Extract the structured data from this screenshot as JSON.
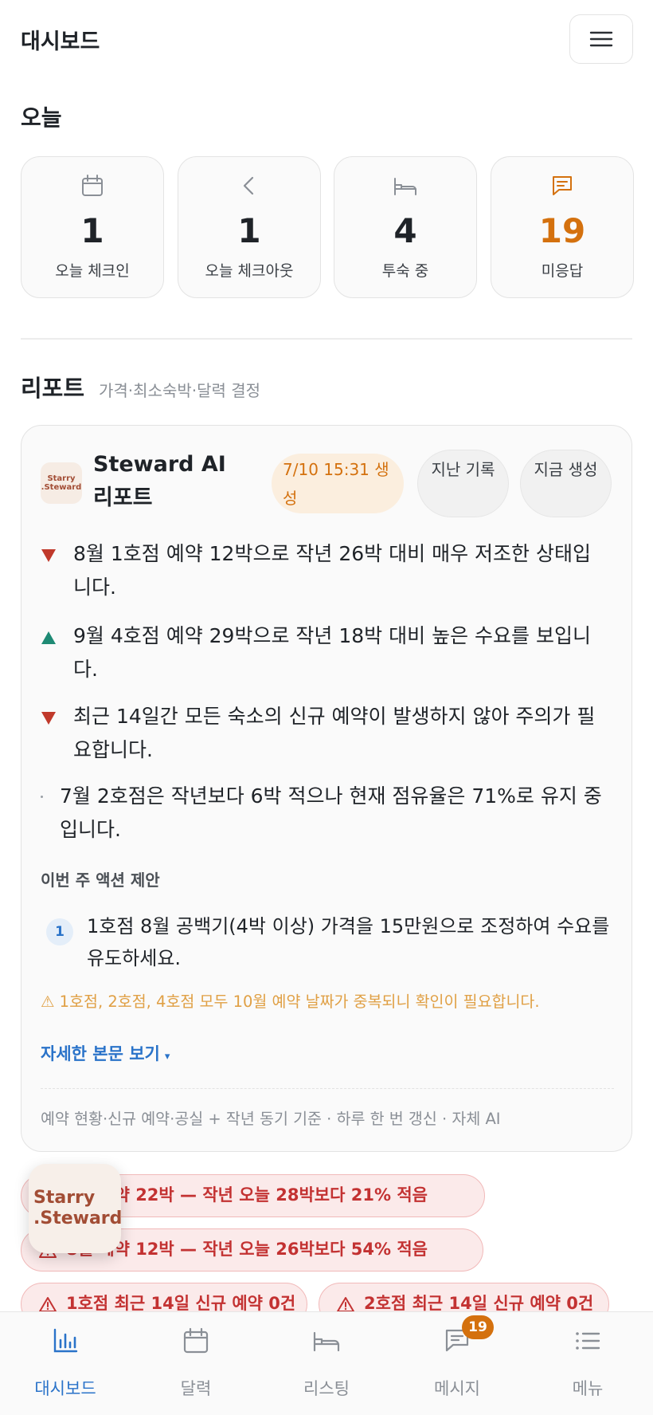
{
  "header": {
    "title": "대시보드"
  },
  "today": {
    "title": "오늘",
    "stats": [
      {
        "icon": "calendar-icon",
        "value": "1",
        "label": "오늘 체크인"
      },
      {
        "icon": "chevron-left-icon",
        "value": "1",
        "label": "오늘 체크아웃"
      },
      {
        "icon": "bed-icon",
        "value": "4",
        "label": "투숙 중"
      },
      {
        "icon": "message-icon",
        "value": "19",
        "label": "미응답"
      }
    ]
  },
  "report": {
    "title": "리포트",
    "subtitle": "가격·최소숙박·달력 결정",
    "card": {
      "logo_line1": "Starry",
      "logo_line2": ".Steward",
      "title": "Steward AI 리포트",
      "generated_badge": "7/10 15:31 생성",
      "history_button": "지난 기록",
      "generate_button": "지금 생성",
      "bullets": [
        {
          "trend": "down",
          "text": "8월 1호점 예약 12박으로 작년 26박 대비 매우 저조한 상태입니다."
        },
        {
          "trend": "up",
          "text": "9월 4호점 예약 29박으로 작년 18박 대비 높은 수요를 보입니다."
        },
        {
          "trend": "down",
          "text": "최근 14일간 모든 숙소의 신규 예약이 발생하지 않아 주의가 필요합니다."
        },
        {
          "trend": "neutral",
          "text": "7월 2호점은 작년보다 6박 적으나 현재 점유율은 71%로 유지 중입니다."
        }
      ],
      "action_heading": "이번 주 액션 제안",
      "actions": [
        {
          "number": "1",
          "text": "1호점 8월 공백기(4박 이상) 가격을 15만원으로 조정하여 수요를 유도하세요."
        }
      ],
      "warning": "⚠ 1호점, 2호점, 4호점 모두 10월 예약 날짜가 중복되니 확인이 필요합니다.",
      "more_link": "자세한 본문 보기",
      "more_caret": "▾",
      "footer": "예약 현황·신규 예약·공실 + 작년 동기 기준 · 하루 한 번 갱신 · 자체 AI"
    }
  },
  "alerts": [
    "7월 예약 22박 — 작년 오늘 28박보다 21% 적음",
    "8월 예약 12박 — 작년 오늘 26박보다 54% 적음",
    "1호점 최근 14일 신규 예약 0건",
    "2호점 최근 14일 신규 예약 0건"
  ],
  "floating_logo": {
    "line1": "Starry",
    "line2": ".Steward"
  },
  "tabbar": {
    "tabs": [
      {
        "label": "대시보드",
        "icon": "chart-icon",
        "active": true
      },
      {
        "label": "달력",
        "icon": "calendar-icon",
        "active": false
      },
      {
        "label": "리스팅",
        "icon": "bed-icon",
        "active": false
      },
      {
        "label": "메시지",
        "icon": "message-icon",
        "active": false
      },
      {
        "label": "메뉴",
        "icon": "list-icon",
        "active": false
      }
    ],
    "message_badge": "19"
  },
  "colors": {
    "accent_blue": "#2a73c9",
    "accent_orange": "#d4710e",
    "trend_down": "#c0392b",
    "trend_up": "#1e8a74",
    "alert_red": "#c33232"
  }
}
